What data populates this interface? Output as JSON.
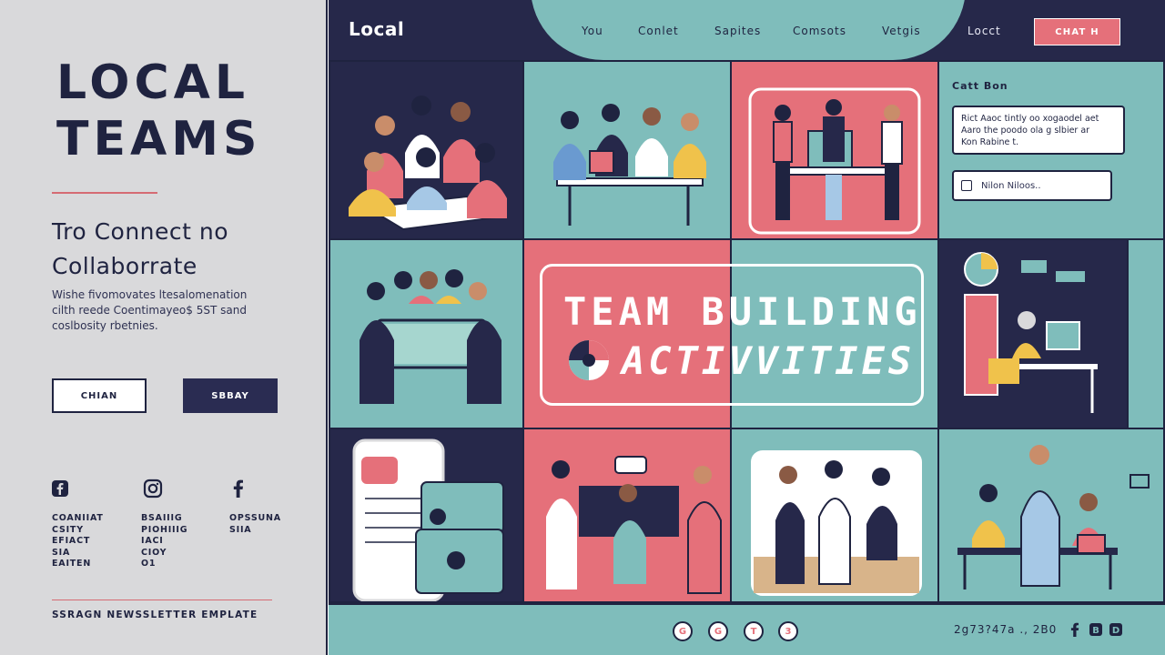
{
  "left": {
    "logo_line1": "LOCAL",
    "logo_line2": "TEAMS",
    "headline_line1": "Tro Connect no",
    "headline_line2": "Collaborrate",
    "paragraph_line1": "Wishe fivomovates ltesalomenation",
    "paragraph_line2": "cilth reede Coentimayeo$ 5ST sand",
    "paragraph_line3": "coslbosity rbetnies.",
    "button_light": "CHIAN",
    "button_dark": "SBBAY",
    "social_icons": [
      "facebook-icon",
      "instagram-icon",
      "facebook-f-icon"
    ],
    "social_col1": [
      "COANIIAT",
      "CSITY",
      "EFIACT",
      "SIA",
      "EAITEN"
    ],
    "social_col2": [
      "BSAIIIG",
      "PIOHIIIG",
      "IACI",
      "CIOY",
      "O1"
    ],
    "social_col3": [
      "OPSSUNA",
      "SIIA"
    ],
    "footer": "SSRAGN NEWSSLETTER EMPLATE"
  },
  "nav": {
    "brand": "Local",
    "items": [
      "You",
      "Conlet",
      "Sapites",
      "Comsots",
      "Vetgis"
    ],
    "login": "Locct",
    "cta": "CHAT H"
  },
  "chat": {
    "title": "Catt Bon",
    "message_line1": "Rict Aaoc tintly oo xogaodel aet",
    "message_line2": "Aaro the poodo ola g slbier ar",
    "message_line3": "Kon Rabine t.",
    "input_placeholder": "Nilon Niloos..",
    "input_icon": "square-icon"
  },
  "banner": {
    "line1": "TEAM BUILDING",
    "line2": "ACTIVVITIES ..",
    "icon": "colorful-ball-icon"
  },
  "footer": {
    "page_dots": [
      "G",
      "G",
      "T",
      "3"
    ],
    "text": "2g73?47a ., 2B0",
    "icons": [
      "facebook-icon",
      "b-square-icon",
      "d-square-icon"
    ]
  },
  "colors": {
    "navy": "#1f2340",
    "teal": "#7fbdbb",
    "coral": "#e5707a",
    "panel_grey": "#d9d9db"
  }
}
